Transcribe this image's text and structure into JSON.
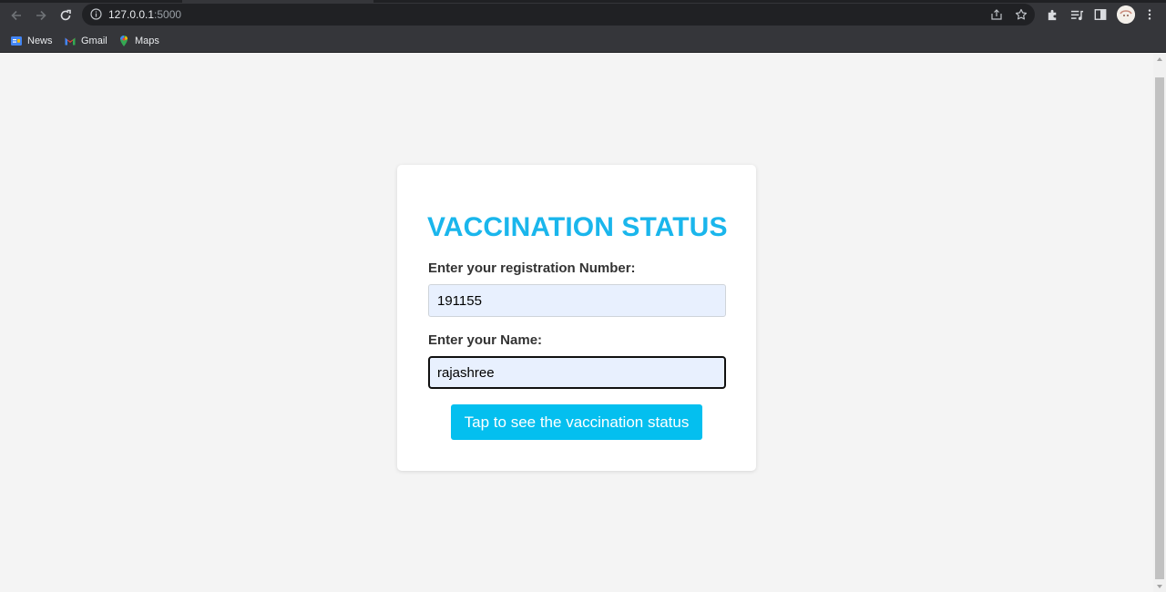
{
  "browser": {
    "url_host": "127.0.0.1",
    "url_port": ":5000",
    "bookmarks": [
      {
        "label": "News"
      },
      {
        "label": "Gmail"
      },
      {
        "label": "Maps"
      }
    ]
  },
  "form": {
    "title": "VACCINATION STATUS",
    "registration_label": "Enter your registration Number:",
    "registration_value": "191155",
    "name_label": "Enter your Name:",
    "name_value": "rajashree",
    "submit_label": "Tap to see the vaccination status"
  },
  "colors": {
    "accent": "#1ab6ec",
    "button": "#04bfef",
    "input_bg": "#e8f0fe",
    "page_bg": "#f4f4f4"
  }
}
